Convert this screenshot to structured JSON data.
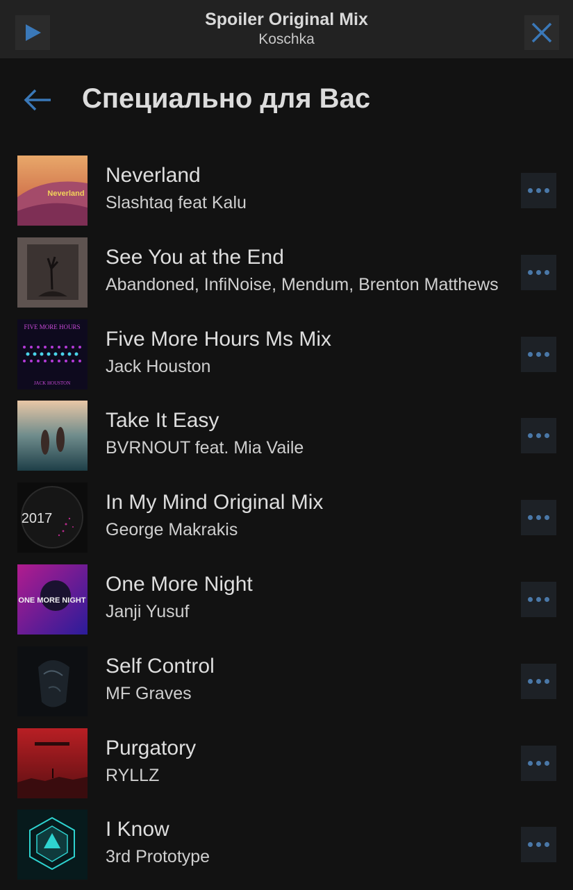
{
  "now_playing": {
    "title": "Spoiler Original Mix",
    "artist": "Koschka",
    "play_icon": "play-icon",
    "close_icon": "close-icon",
    "accent_color": "#3a78b8"
  },
  "header": {
    "back_icon": "arrow-left-icon",
    "title": "Специально для Вас"
  },
  "tracks": [
    {
      "title": "Neverland",
      "artist": "Slashtaq feat Kalu",
      "cover_text": "Neverland"
    },
    {
      "title": "See You at the End",
      "artist": "Abandoned, InfiNoise, Mendum, Brenton Matthews"
    },
    {
      "title": "Five More Hours Ms Mix",
      "artist": "Jack Houston",
      "cover_text": "FIVE MORE HOURS",
      "cover_subtext": "JACK HOUSTON"
    },
    {
      "title": "Take It Easy",
      "artist": "BVRNOUT feat. Mia Vaile"
    },
    {
      "title": "In My Mind Original Mix",
      "artist": "George Makrakis",
      "cover_text": "2017"
    },
    {
      "title": "One More Night",
      "artist": "Janji Yusuf",
      "cover_text": "ONE MORE NIGHT"
    },
    {
      "title": "Self Control",
      "artist": "MF Graves"
    },
    {
      "title": "Purgatory",
      "artist": "RYLLZ"
    },
    {
      "title": "I Know",
      "artist": "3rd Prototype"
    }
  ]
}
